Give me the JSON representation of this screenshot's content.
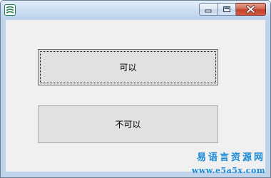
{
  "window": {
    "icon": "easy-language-app-icon",
    "controls": {
      "minimize_icon": "minimize-icon",
      "maximize_icon": "maximize-icon",
      "close_icon": "close-icon"
    }
  },
  "buttons": {
    "first_label": "可以",
    "second_label": "不可以"
  },
  "watermark": {
    "chinese": "易语言资源网",
    "url": "www.e5a5x.com"
  },
  "colors": {
    "titlebar": "#cfe0f4",
    "client_background": "#f0f0f0",
    "close_button": "#c4412a",
    "watermark": "#1b8bd6"
  }
}
